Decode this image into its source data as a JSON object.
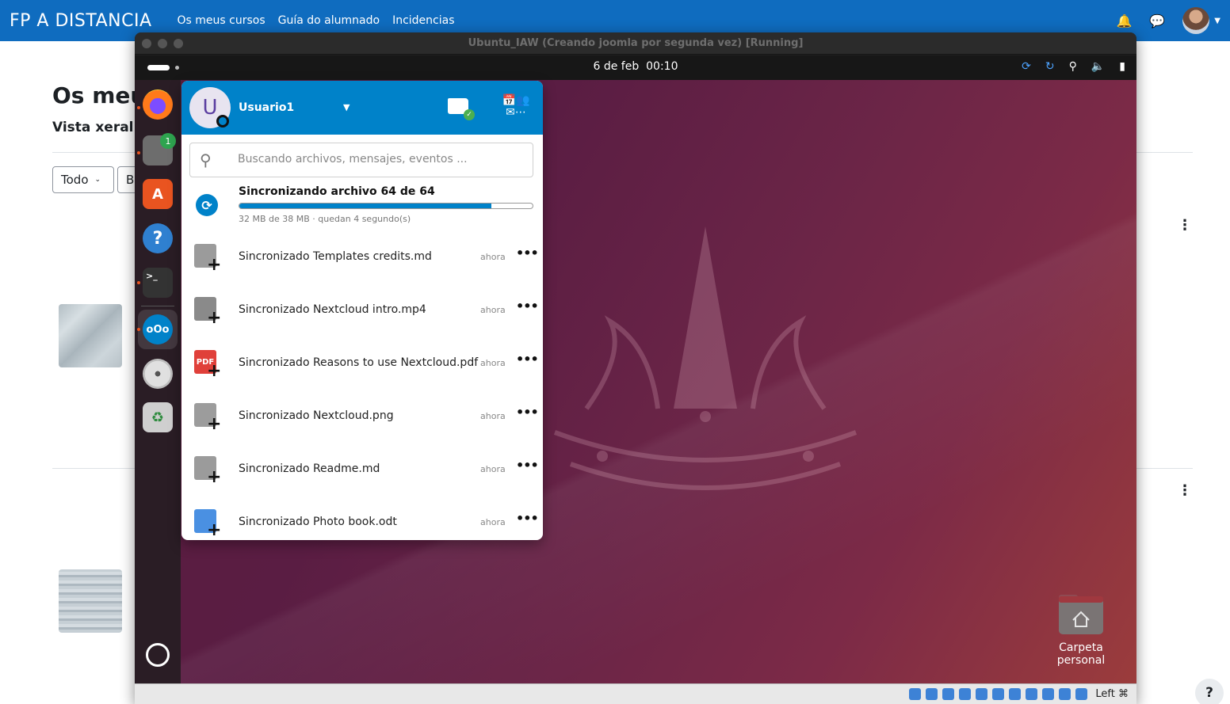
{
  "moodle": {
    "brand": "FP A DISTANCIA",
    "nav": [
      "Os meus cursos",
      "Guía do alumnado",
      "Incidencias"
    ],
    "page_title": "Os meus cursos",
    "page_subtitle": "Vista xeral dos cursos",
    "filter": "Todo",
    "filter2": "B",
    "help": "?"
  },
  "vm": {
    "title": "Ubuntu_IAW (Creando joomla por segunda vez) [Running]",
    "host_key": "Left ⌘"
  },
  "ubuntu": {
    "date": "6 de feb",
    "time": "00:10",
    "files_badge": "1",
    "desktop_home_label": "Carpeta personal"
  },
  "nextcloud": {
    "avatar_initial": "U",
    "username": "Usuario1",
    "search_placeholder": "Buscando archivos, mensajes, eventos ...",
    "sync": {
      "title": "Sincronizando archivo 64 de 64",
      "progress": 0.86,
      "detail": "32 MB de 38 MB · quedan 4 segundo(s)"
    },
    "activities": [
      {
        "text": "Sincronizado Templates credits.md",
        "time": "ahora",
        "icon": "text-file-icon"
      },
      {
        "text": "Sincronizado Nextcloud intro.mp4",
        "time": "ahora",
        "icon": "video-file-icon"
      },
      {
        "text": "Sincronizado Reasons to use Nextcloud.pdf",
        "time": "ahora",
        "icon": "pdf-file-icon"
      },
      {
        "text": "Sincronizado Nextcloud.png",
        "time": "ahora",
        "icon": "image-file-icon"
      },
      {
        "text": "Sincronizado Readme.md",
        "time": "ahora",
        "icon": "text-file-icon"
      },
      {
        "text": "Sincronizado Photo book.odt",
        "time": "ahora",
        "icon": "document-file-icon"
      }
    ],
    "more_label": "•••",
    "pdf_label": "PDF"
  }
}
